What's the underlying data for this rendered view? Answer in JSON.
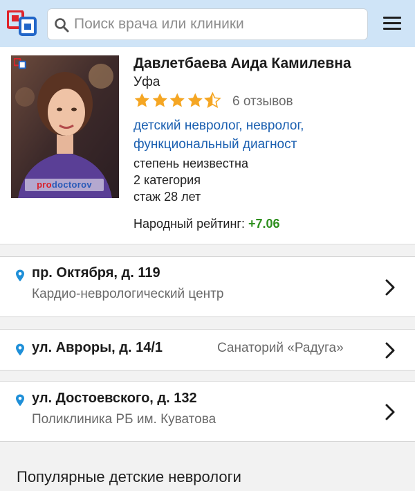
{
  "header": {
    "search_placeholder": "Поиск врача или клиники",
    "logo_icon": "prodoctorov-logo",
    "menu_icon": "hamburger-menu-icon"
  },
  "doctor": {
    "name": "Давлетбаева Аида Камилевна",
    "city": "Уфа",
    "stars": 4.5,
    "reviews": "6 отзывов",
    "specialties": [
      "детский невролог",
      "невролог",
      "функциональный диагност"
    ],
    "degree": "степень неизвестна",
    "category": "2 категория",
    "experience": "стаж 28 лет",
    "rating_label": "Народный рейтинг:",
    "rating_value": "+7.06",
    "photo_watermark_pro": "pro",
    "photo_watermark_doctorov": "doctorov"
  },
  "addresses": [
    {
      "street": "пр. Октября, д. 119",
      "clinic": "Кардио-неврологический центр"
    },
    {
      "street": "ул. Авроры, д. 14/1",
      "clinic": "Санаторий «Радуга»"
    },
    {
      "street": "ул. Достоевского, д. 132",
      "clinic": "Поликлиника РБ им. Куватова"
    }
  ],
  "section": {
    "title": "Популярные детские неврологи"
  },
  "colors": {
    "header_bg": "#cfe4f7",
    "link": "#1a5fb0",
    "rating_positive": "#2e8f1e",
    "star": "#f5a623",
    "pin": "#1e8fd8",
    "logo_red": "#e0242b",
    "logo_blue": "#2266c8"
  }
}
